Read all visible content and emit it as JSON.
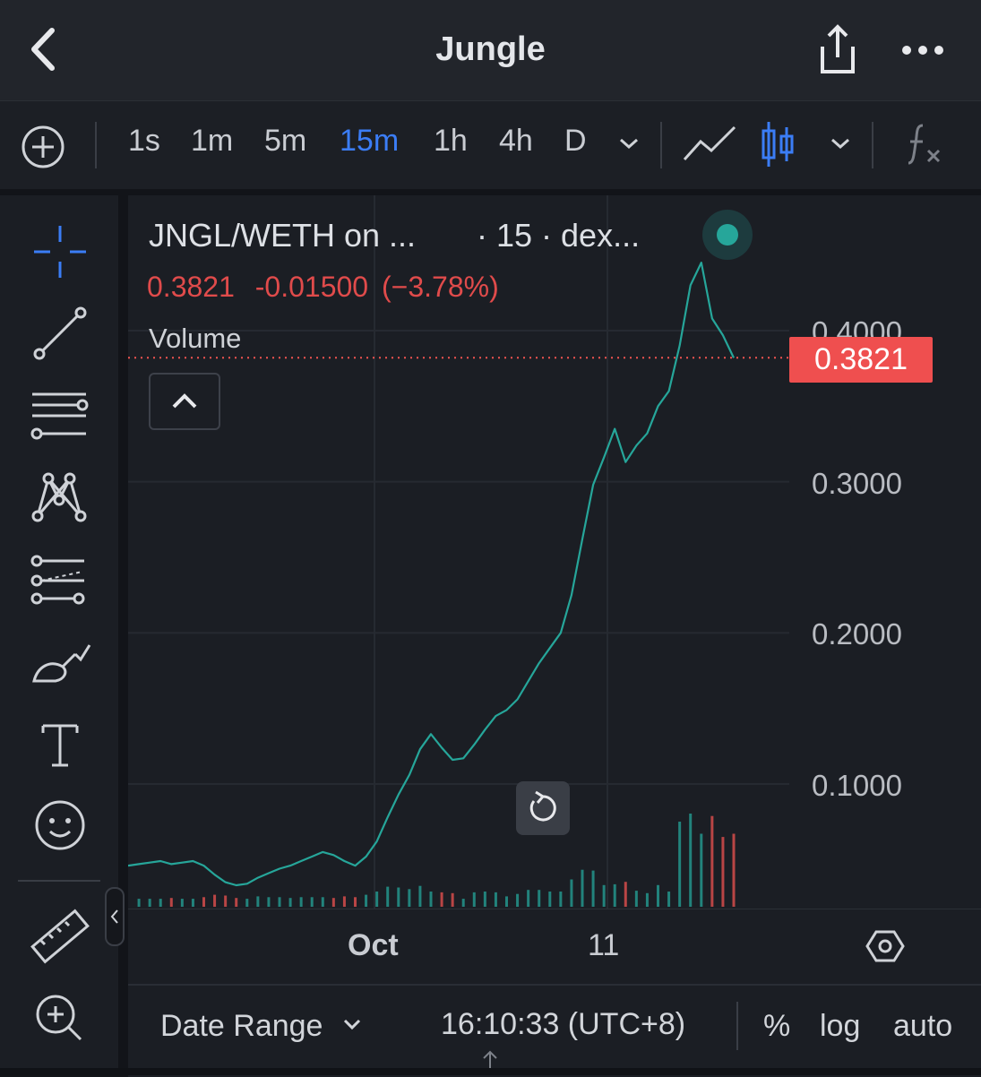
{
  "header": {
    "title": "Jungle",
    "back_icon": "chevron-left-icon",
    "share_icon": "share-icon",
    "more_icon": "more-horizontal-icon"
  },
  "toolbar": {
    "add_icon": "plus-circle-icon",
    "intervals": [
      "1s",
      "1m",
      "5m",
      "15m",
      "1h",
      "4h",
      "D"
    ],
    "active_interval": "15m",
    "line_chart_icon": "line-chart-icon",
    "candle_chart_icon": "candlestick-icon",
    "indicator_icon": "fx-icon"
  },
  "left_tools": [
    "crosshair-icon",
    "trendline-icon",
    "horizontal-lines-icon",
    "pattern-icon",
    "forecast-icon",
    "brush-icon",
    "text-icon",
    "emoji-icon",
    "ruler-icon",
    "zoom-in-icon"
  ],
  "legend": {
    "symbol": "JNGL/WETH on ...",
    "extra": "· 15 · dex...",
    "last": "0.3821",
    "change": "-0.01500",
    "change_pct": "(−3.78%)",
    "volume_label": "Volume"
  },
  "price_tag": "0.3821",
  "chart_data": {
    "type": "line",
    "title": "",
    "xlabel": "",
    "ylabel": "",
    "y_ticks": [
      "0.4000",
      "0.3000",
      "0.2000",
      "0.1000"
    ],
    "x_ticks": [
      "Oct",
      "11"
    ],
    "ylim": [
      0.0,
      0.45
    ],
    "last_price": 0.3821,
    "series": [
      {
        "values": [
          0.046,
          0.047,
          0.048,
          0.049,
          0.047,
          0.048,
          0.049,
          0.046,
          0.04,
          0.035,
          0.033,
          0.034,
          0.038,
          0.041,
          0.044,
          0.046,
          0.049,
          0.052,
          0.055,
          0.053,
          0.049,
          0.046,
          0.052,
          0.062,
          0.078,
          0.093,
          0.106,
          0.123,
          0.133,
          0.124,
          0.116,
          0.117,
          0.126,
          0.136,
          0.145,
          0.149,
          0.156,
          0.168,
          0.18,
          0.19,
          0.2,
          0.225,
          0.262,
          0.298,
          0.316,
          0.335,
          0.313,
          0.324,
          0.332,
          0.35,
          0.36,
          0.39,
          0.43,
          0.445,
          0.408,
          0.397,
          0.382
        ]
      }
    ]
  },
  "x_axis": {
    "oct": "Oct",
    "day11": "11"
  },
  "bottom": {
    "date_range": "Date Range",
    "time": "16:10:33 (UTC+8)",
    "percent": "%",
    "log": "log",
    "auto": "auto"
  },
  "colors": {
    "up": "#26a69a",
    "down": "#ef5350",
    "accent": "#3b7df6"
  }
}
